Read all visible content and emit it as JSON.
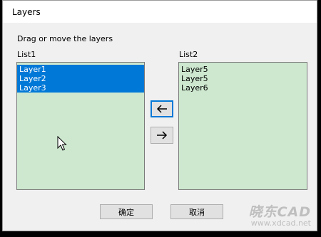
{
  "window": {
    "title": "Layers"
  },
  "instruction": "Drag or move the layers",
  "list1": {
    "label": "List1",
    "items": [
      {
        "text": "Layer1",
        "selected": true
      },
      {
        "text": "Layer2",
        "selected": true
      },
      {
        "text": "Layer3",
        "selected": true
      }
    ]
  },
  "list2": {
    "label": "List2",
    "items": [
      {
        "text": "Layer5",
        "selected": false
      },
      {
        "text": "Layer5",
        "selected": false
      },
      {
        "text": "Layer6",
        "selected": false
      }
    ]
  },
  "buttons": {
    "move_left_icon": "arrow-left-icon",
    "move_right_icon": "arrow-right-icon",
    "ok": "确定",
    "cancel": "取消"
  },
  "watermark": {
    "logo": "晓东CAD",
    "url": "www.xdcad.net"
  },
  "colors": {
    "list_background": "#cde8cf",
    "selection": "#0078d7",
    "dialog_background": "#f0f0f0"
  }
}
